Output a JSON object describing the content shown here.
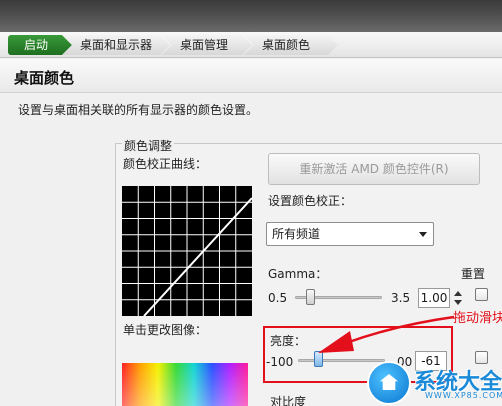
{
  "breadcrumb": {
    "home": "启动",
    "items": [
      "桌面和显示器",
      "桌面管理",
      "桌面颜色"
    ]
  },
  "page": {
    "title": "桌面颜色",
    "description": "设置与桌面相关联的所有显示器的颜色设置。"
  },
  "color_adjust": {
    "group_label": "颜色调整",
    "curve_label": "颜色校正曲线：",
    "reactivate_button": "重新激活 AMD 颜色控件(R)",
    "set_correction_label": "设置颜色校正：",
    "channel_select_value": "所有频道",
    "reset_label": "重置",
    "preview_label": "单击更改图像：",
    "gamma": {
      "label": "Gamma：",
      "min": "0.5",
      "max": "3.5",
      "value": "1.00",
      "level": 0.17
    },
    "brightness": {
      "label": "亮度：",
      "min": "-100",
      "max_partial": "00",
      "value_partial": "-61"
    },
    "contrast_label": "对比度"
  },
  "annotation": {
    "text": "拖动滑块",
    "color": "#e3101b"
  },
  "watermark": {
    "brand": "系统大全",
    "url": "WWW.XP85.COM"
  },
  "colors": {
    "home_crumb": "#2a8a2a",
    "highlight": "#e3101b",
    "watermark": "#1a8ad8"
  }
}
